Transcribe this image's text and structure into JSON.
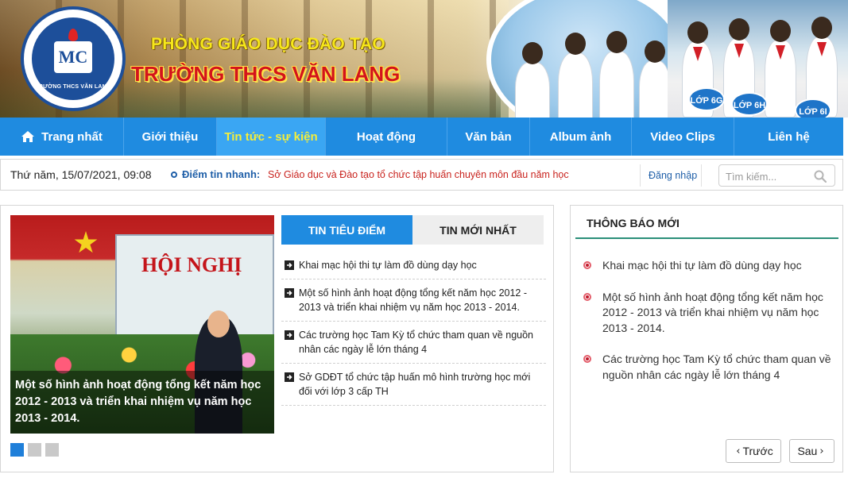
{
  "header": {
    "logo_text": "TRƯỜNG THCS VĂN LANG",
    "logo_mark": "MC",
    "title_line1": "PHÒNG GIÁO DỤC ĐÀO TẠO",
    "title_line2": "TRƯỜNG THCS VĂN LANG",
    "signs": [
      "LỚP 6G",
      "LỚP 6H",
      "LỚP 6I"
    ]
  },
  "nav": {
    "items": [
      {
        "label": "Trang nhất",
        "icon": "home-icon"
      },
      {
        "label": "Giới thiệu"
      },
      {
        "label": "Tin tức - sự kiện",
        "active": true
      },
      {
        "label": "Hoạt động"
      },
      {
        "label": "Văn bản"
      },
      {
        "label": "Album ảnh"
      },
      {
        "label": "Video Clips"
      },
      {
        "label": "Liên hệ"
      }
    ]
  },
  "infobar": {
    "datetime": "Thứ năm, 15/07/2021, 09:08",
    "news_label": "Điểm tin nhanh:",
    "news_text": "Sở Giáo dục và Đào tạo tổ chức tập huấn chuyên môn đầu năm học",
    "login": "Đăng nhập",
    "search_placeholder": "Tìm kiếm..."
  },
  "featured": {
    "slide_sign": "HỘI NGHỊ",
    "caption": "Một số hình ảnh hoạt động tổng kết năm học 2012 - 2013 và triển khai nhiệm vụ năm học 2013 - 2014.",
    "slides_count": 3,
    "active_slide": 1
  },
  "tabs": {
    "tab1": "TIN TIÊU ĐIỂM",
    "tab2": "TIN MỚI NHẤT"
  },
  "news_list": [
    "Khai mạc hội thi tự làm đồ dùng dạy học",
    "Một số hình ảnh hoạt động tổng kết năm học 2012 - 2013 và triển khai nhiệm vụ năm học 2013 - 2014.",
    "Các trường học Tam Kỳ tổ chức tham quan về nguồn nhân các ngày lễ lớn tháng 4",
    "Sở GDĐT tổ chức tập huấn mô hình trường học mới đối với lớp 3 cấp TH"
  ],
  "notice": {
    "title": "THÔNG BÁO MỚI",
    "items": [
      "Khai mạc hội thi tự làm đồ dùng dạy học",
      "Một số hình ảnh hoạt động tổng kết năm học 2012 - 2013 và triển khai nhiệm vụ năm học 2013 - 2014.",
      "Các trường học Tam Kỳ tổ chức tham quan về nguồn nhân các ngày lễ lớn tháng 4"
    ],
    "prev": "Trước",
    "next": "Sau"
  },
  "colors": {
    "nav_blue": "#1f8be0",
    "nav_active_text": "#f5ee3a",
    "news_red": "#c9241f",
    "link_blue": "#1f5fa8",
    "notice_underline": "#2a8f79"
  }
}
